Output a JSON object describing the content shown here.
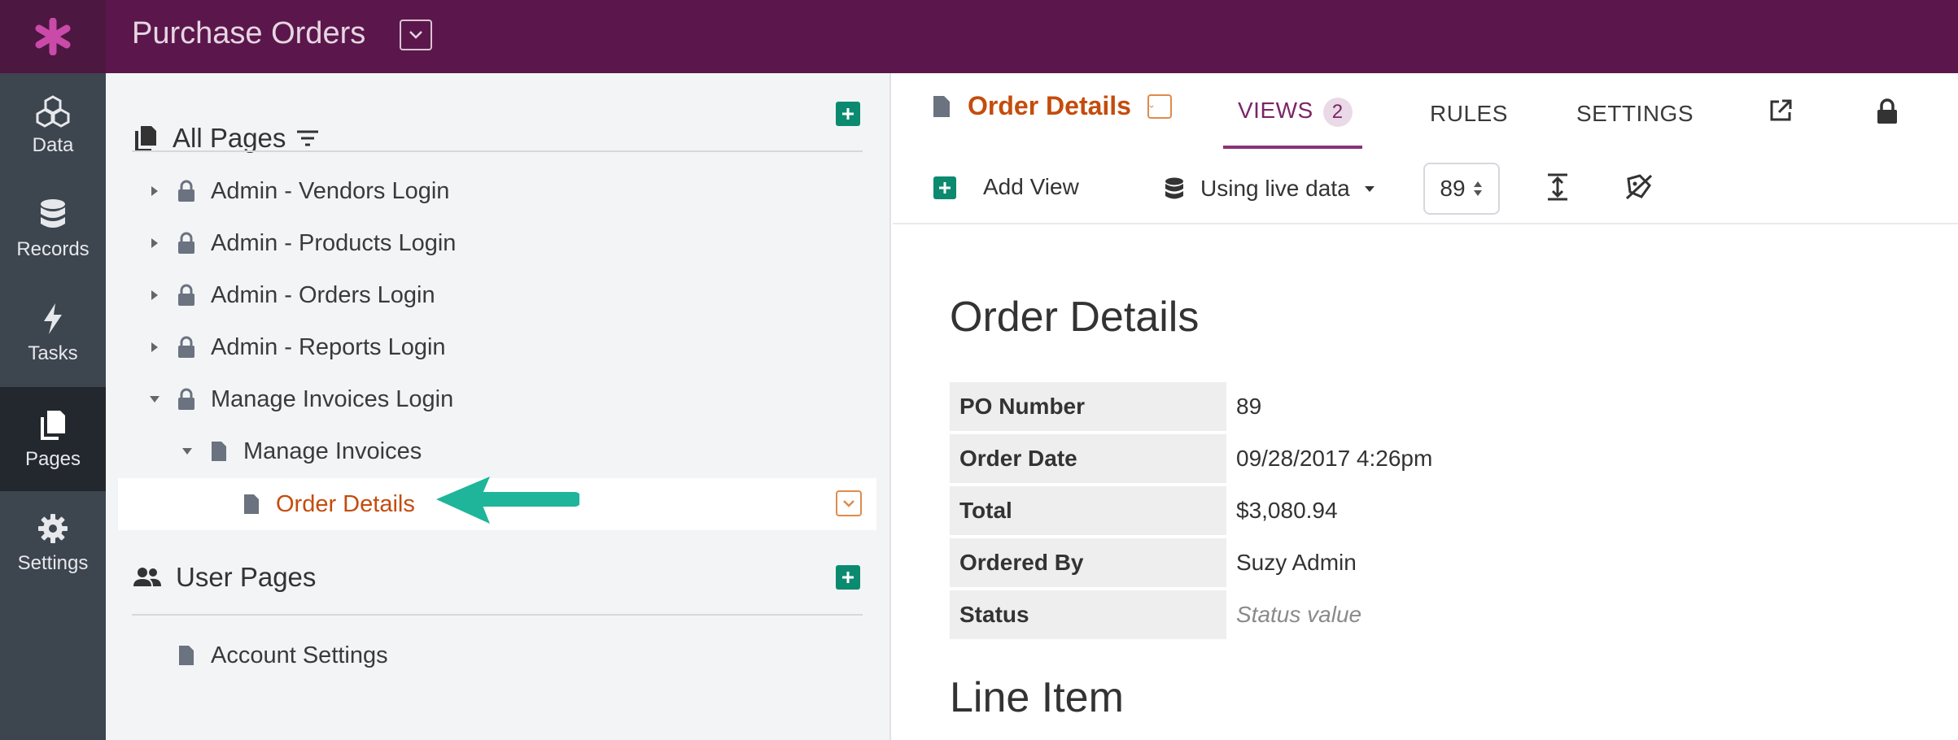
{
  "app": {
    "title": "Purchase Orders",
    "brand_color": "#5b174b"
  },
  "rail": {
    "items": [
      {
        "label": "Data",
        "icon": "cubes-icon"
      },
      {
        "label": "Records",
        "icon": "database-icon"
      },
      {
        "label": "Tasks",
        "icon": "lightning-icon"
      },
      {
        "label": "Pages",
        "icon": "pages-icon",
        "active": true
      },
      {
        "label": "Settings",
        "icon": "gear-icon"
      }
    ]
  },
  "tree": {
    "all_pages_label": "All Pages",
    "rows": [
      {
        "label": "Admin - Vendors Login",
        "caret": "right",
        "icon": "lock-icon"
      },
      {
        "label": "Admin - Products Login",
        "caret": "right",
        "icon": "lock-icon"
      },
      {
        "label": "Admin - Orders Login",
        "caret": "right",
        "icon": "lock-icon"
      },
      {
        "label": "Admin - Reports Login",
        "caret": "right",
        "icon": "lock-icon"
      },
      {
        "label": "Manage Invoices Login",
        "caret": "down",
        "icon": "lock-icon"
      },
      {
        "label": "Manage Invoices",
        "caret": "down",
        "icon": "page-icon"
      },
      {
        "label": "Order Details",
        "icon": "page-icon",
        "selected": true
      }
    ],
    "user_pages_label": "User Pages",
    "user_rows": [
      {
        "label": "Account Settings",
        "icon": "page-icon"
      }
    ]
  },
  "content": {
    "page_title": "Order Details",
    "tabs": {
      "views": "VIEWS",
      "views_count": "2",
      "rules": "RULES",
      "settings": "SETTINGS"
    },
    "toolbar": {
      "add_view": "Add View",
      "live_data": "Using live data",
      "record_id": "89"
    },
    "view": {
      "heading": "Order Details",
      "fields": [
        {
          "label": "PO Number",
          "value": "89"
        },
        {
          "label": "Order Date",
          "value": "09/28/2017 4:26pm"
        },
        {
          "label": "Total",
          "value": "$3,080.94"
        },
        {
          "label": "Ordered By",
          "value": "Suzy Admin"
        },
        {
          "label": "Status",
          "value": "Status value",
          "placeholder": true
        }
      ],
      "heading2": "Line Item"
    }
  }
}
